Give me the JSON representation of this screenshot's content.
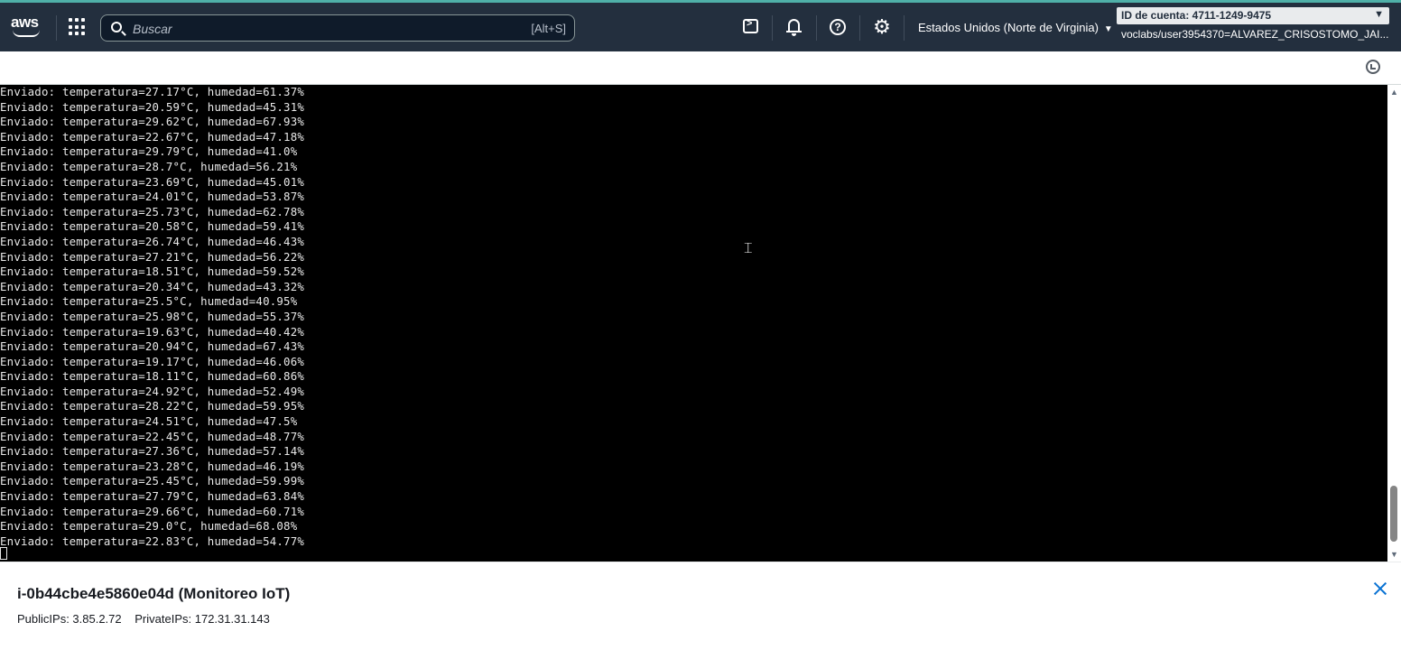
{
  "nav": {
    "logo_text": "aws",
    "search_placeholder": "Buscar",
    "search_shortcut": "[Alt+S]",
    "region": "Estados Unidos (Norte de Virginia)",
    "account_id": "ID de cuenta: 4711-1249-9475",
    "user": "voclabs/user3954370=ALVAREZ_CRISOSTOMO_JAI...",
    "icons": [
      "apps-grid-icon",
      "search-icon",
      "cloudshell-icon",
      "bell-icon",
      "help-icon",
      "gear-icon",
      "refresh-icon"
    ]
  },
  "terminal": {
    "lines": [
      "Enviado: temperatura=27.17°C, humedad=61.37%",
      "Enviado: temperatura=20.59°C, humedad=45.31%",
      "Enviado: temperatura=29.62°C, humedad=67.93%",
      "Enviado: temperatura=22.67°C, humedad=47.18%",
      "Enviado: temperatura=29.79°C, humedad=41.0%",
      "Enviado: temperatura=28.7°C, humedad=56.21%",
      "Enviado: temperatura=23.69°C, humedad=45.01%",
      "Enviado: temperatura=24.01°C, humedad=53.87%",
      "Enviado: temperatura=25.73°C, humedad=62.78%",
      "Enviado: temperatura=20.58°C, humedad=59.41%",
      "Enviado: temperatura=26.74°C, humedad=46.43%",
      "Enviado: temperatura=27.21°C, humedad=56.22%",
      "Enviado: temperatura=18.51°C, humedad=59.52%",
      "Enviado: temperatura=20.34°C, humedad=43.32%",
      "Enviado: temperatura=25.5°C, humedad=40.95%",
      "Enviado: temperatura=25.98°C, humedad=55.37%",
      "Enviado: temperatura=19.63°C, humedad=40.42%",
      "Enviado: temperatura=20.94°C, humedad=67.43%",
      "Enviado: temperatura=19.17°C, humedad=46.06%",
      "Enviado: temperatura=18.11°C, humedad=60.86%",
      "Enviado: temperatura=24.92°C, humedad=52.49%",
      "Enviado: temperatura=28.22°C, humedad=59.95%",
      "Enviado: temperatura=24.51°C, humedad=47.5%",
      "Enviado: temperatura=22.45°C, humedad=48.77%",
      "Enviado: temperatura=27.36°C, humedad=57.14%",
      "Enviado: temperatura=23.28°C, humedad=46.19%",
      "Enviado: temperatura=25.45°C, humedad=59.99%",
      "Enviado: temperatura=27.79°C, humedad=63.84%",
      "Enviado: temperatura=29.66°C, humedad=60.71%",
      "Enviado: temperatura=29.0°C, humedad=68.08%",
      "Enviado: temperatura=22.83°C, humedad=54.77%"
    ]
  },
  "instance": {
    "title": "i-0b44cbe4e5860e04d (Monitoreo IoT)",
    "public_ips": "PublicIPs: 3.85.2.72",
    "private_ips": "PrivateIPs: 172.31.31.143"
  },
  "colors": {
    "nav_bg": "#232f3e",
    "terminal_bg": "#000000",
    "close_accent": "#0972d3"
  }
}
